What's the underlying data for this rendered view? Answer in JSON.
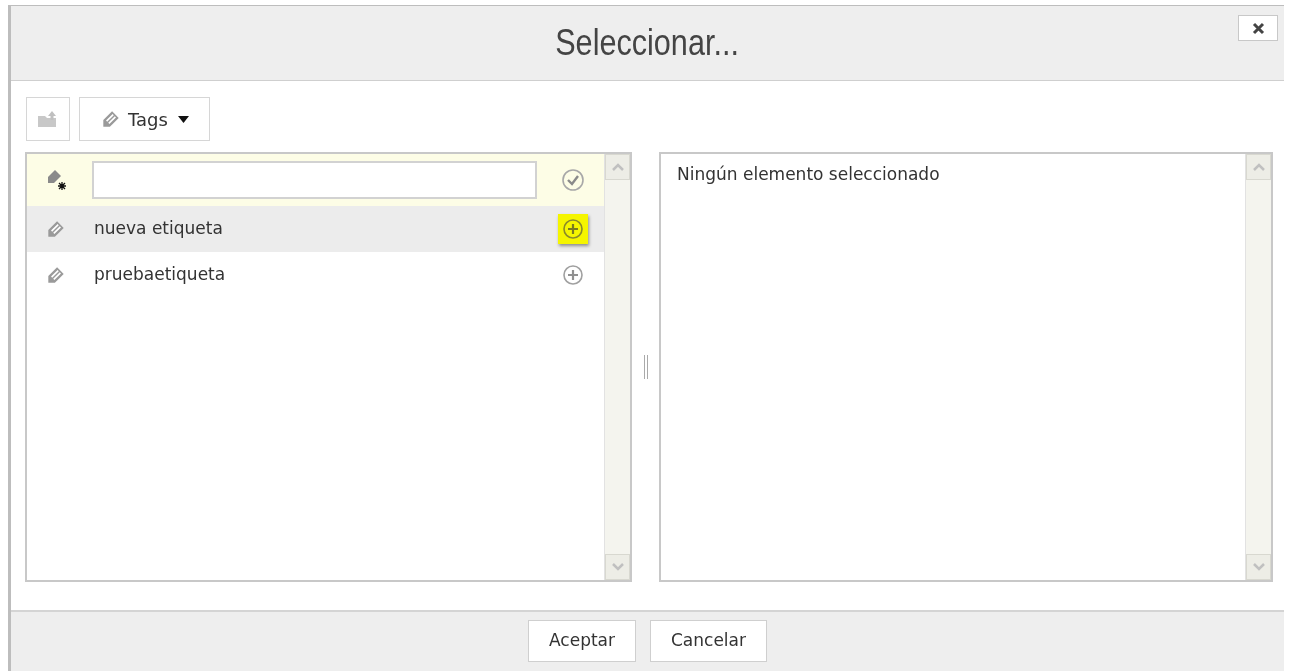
{
  "dialog": {
    "title": "Seleccionar..."
  },
  "toolbar": {
    "tags_button": {
      "label": "Tags"
    }
  },
  "tags": [
    {
      "label": "nueva etiqueta",
      "hovered": true
    },
    {
      "label": "pruebaetiqueta",
      "hovered": false
    }
  ],
  "selection_panel": {
    "text": "Ningún elemento seleccionado"
  },
  "buttons": [
    {
      "label": "Aceptar"
    },
    {
      "label": "Cancelar"
    }
  ]
}
